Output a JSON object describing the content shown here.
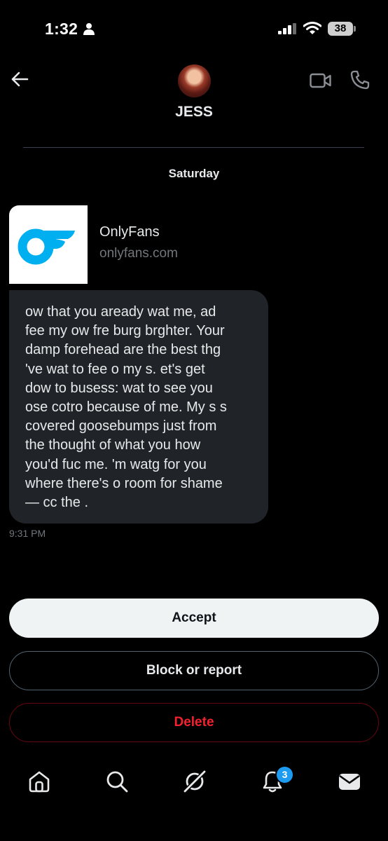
{
  "status_bar": {
    "time": "1:32",
    "battery": "38",
    "icons": [
      "person-icon",
      "signal-icon",
      "wifi-icon",
      "battery-icon"
    ]
  },
  "header": {
    "title": "JESS",
    "icons": [
      "back-arrow-icon",
      "avatar",
      "video-call-icon",
      "phone-call-icon"
    ]
  },
  "conversation": {
    "date_label": "Saturday",
    "link_card": {
      "title": "OnlyFans",
      "domain": "onlyfans.com",
      "accent_color": "#00AFF0"
    },
    "message": {
      "text": "ow that you aready wat me, ad\nfee my ow fre burg brghter. Your\ndamp forehead are the best thg\n've wat to fee o my s. et's get\ndow to busess:  wat to see you\nose cotro because of me. My s s\ncovered  goosebumps just from\nthe thought of what you how\nyou'd fuc me. 'm watg for you\nwhere there's o room for shame\n— cc the .",
      "time": "9:31 PM"
    }
  },
  "actions": {
    "accept": "Accept",
    "block": "Block or report",
    "delete": "Delete"
  },
  "bottom_nav": {
    "notification_count": "3",
    "items": [
      "home-icon",
      "search-icon",
      "grok-icon",
      "notifications-icon",
      "messages-icon"
    ]
  },
  "colors": {
    "background": "#000000",
    "bubble": "#202327",
    "delete": "#F4212E",
    "badge": "#1D9BF0"
  }
}
